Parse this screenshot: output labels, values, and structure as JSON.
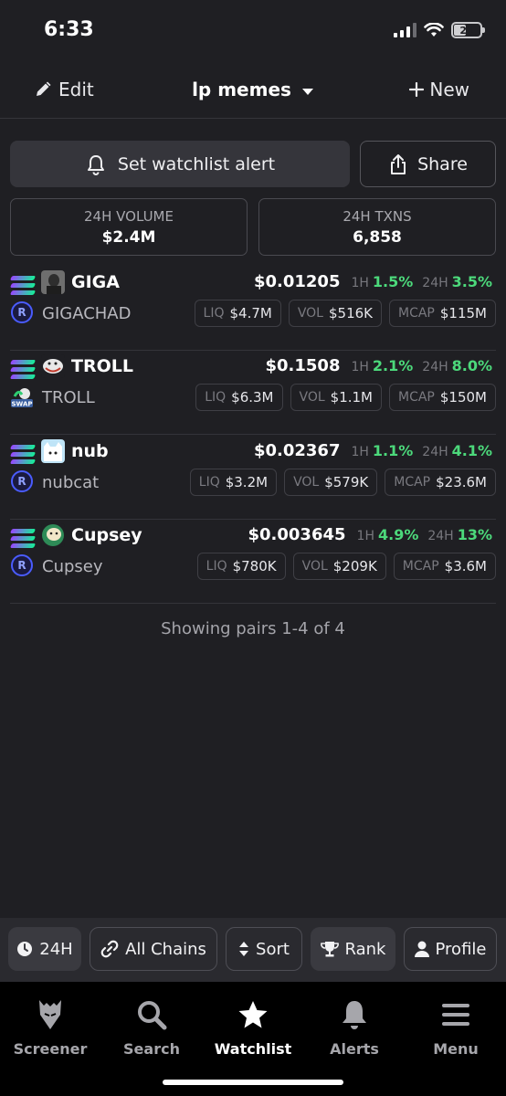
{
  "status_bar": {
    "time": "6:33",
    "battery": "21"
  },
  "header": {
    "edit_label": "Edit",
    "title": "lp memes",
    "new_label": "New"
  },
  "actions": {
    "alert_label": "Set watchlist alert",
    "share_label": "Share"
  },
  "stats": {
    "volume_label": "24H VOLUME",
    "volume_value": "$2.4M",
    "txns_label": "24H TXNS",
    "txns_value": "6,858"
  },
  "labels": {
    "h1": "1H",
    "h24": "24H",
    "liq": "LIQ",
    "vol": "VOL",
    "mcap": "MCAP"
  },
  "pairs": [
    {
      "symbol": "GIGA",
      "name": "GIGACHAD",
      "price": "$0.01205",
      "change_1h": "1.5%",
      "change_24h": "3.5%",
      "liq": "$4.7M",
      "vol": "$516K",
      "mcap": "$115M"
    },
    {
      "symbol": "TROLL",
      "name": "TROLL",
      "price": "$0.1508",
      "change_1h": "2.1%",
      "change_24h": "8.0%",
      "liq": "$6.3M",
      "vol": "$1.1M",
      "mcap": "$150M"
    },
    {
      "symbol": "nub",
      "name": "nubcat",
      "price": "$0.02367",
      "change_1h": "1.1%",
      "change_24h": "4.1%",
      "liq": "$3.2M",
      "vol": "$579K",
      "mcap": "$23.6M"
    },
    {
      "symbol": "Cupsey",
      "name": "Cupsey",
      "price": "$0.003645",
      "change_1h": "4.9%",
      "change_24h": "13%",
      "liq": "$780K",
      "vol": "$209K",
      "mcap": "$3.6M"
    }
  ],
  "footer_text": "Showing pairs 1-4 of 4",
  "filters": {
    "timeframe": "24H",
    "chains": "All Chains",
    "sort": "Sort",
    "rank": "Rank",
    "profile": "Profile"
  },
  "tabs": {
    "screener": "Screener",
    "search": "Search",
    "watchlist": "Watchlist",
    "alerts": "Alerts",
    "menu": "Menu"
  },
  "colors": {
    "positive": "#4cd97b",
    "background": "#1f1f23",
    "solana_gradient": [
      "#9945ff",
      "#14f195"
    ],
    "raydium": "#4a5cff"
  }
}
